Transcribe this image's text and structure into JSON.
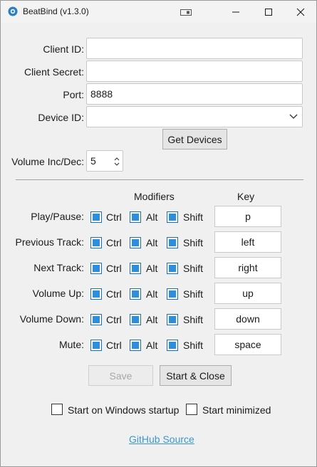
{
  "window": {
    "title": "BeatBind (v1.3.0)"
  },
  "form": {
    "client_id_label": "Client ID:",
    "client_id_value": "",
    "client_secret_label": "Client Secret:",
    "client_secret_value": "",
    "port_label": "Port:",
    "port_value": "8888",
    "device_id_label": "Device ID:",
    "device_id_value": "",
    "get_devices_label": "Get Devices",
    "volume_label": "Volume Inc/Dec:",
    "volume_value": "5"
  },
  "hotkeys": {
    "modifiers_header": "Modifiers",
    "key_header": "Key",
    "mod_labels": {
      "ctrl": "Ctrl",
      "alt": "Alt",
      "shift": "Shift"
    },
    "rows": [
      {
        "label": "Play/Pause:",
        "ctrl": true,
        "alt": true,
        "shift": true,
        "key": "p"
      },
      {
        "label": "Previous Track:",
        "ctrl": true,
        "alt": true,
        "shift": true,
        "key": "left"
      },
      {
        "label": "Next Track:",
        "ctrl": true,
        "alt": true,
        "shift": true,
        "key": "right"
      },
      {
        "label": "Volume Up:",
        "ctrl": true,
        "alt": true,
        "shift": true,
        "key": "up"
      },
      {
        "label": "Volume Down:",
        "ctrl": true,
        "alt": true,
        "shift": true,
        "key": "down"
      },
      {
        "label": "Mute:",
        "ctrl": true,
        "alt": true,
        "shift": true,
        "key": "space"
      }
    ]
  },
  "actions": {
    "save_label": "Save",
    "start_close_label": "Start & Close"
  },
  "options": {
    "startup_label": "Start on Windows startup",
    "startup_checked": false,
    "minimized_label": "Start minimized",
    "minimized_checked": false
  },
  "footer": {
    "link_text": "GitHub Source"
  },
  "colors": {
    "checkbox_fill": "#2d8ede",
    "link": "#3a97c9"
  }
}
